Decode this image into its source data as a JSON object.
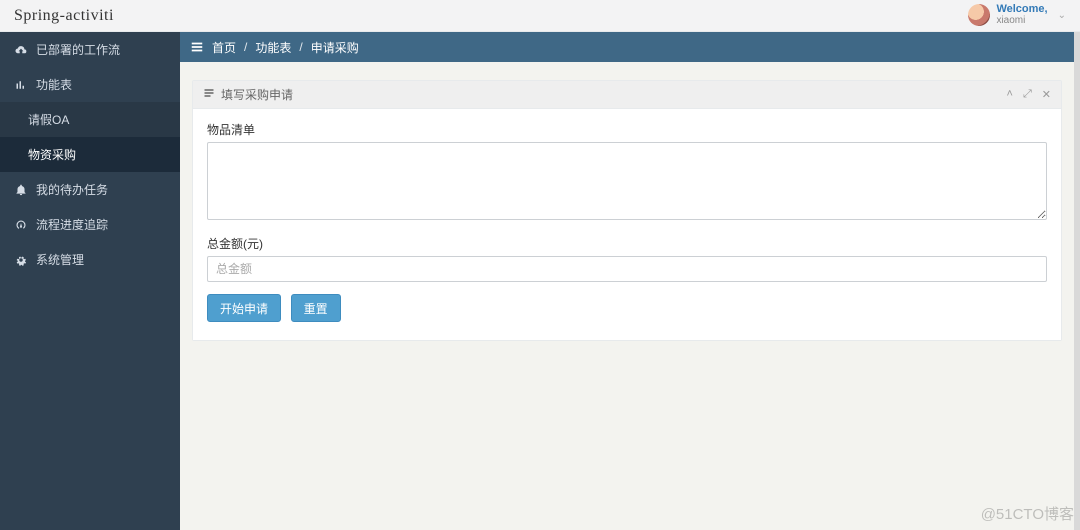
{
  "header": {
    "brand": "Spring-activiti",
    "welcome": "Welcome,",
    "username": "xiaomi"
  },
  "sidebar": {
    "items": [
      {
        "label": "已部署的工作流",
        "icon": "cloud-upload"
      },
      {
        "label": "功能表",
        "icon": "bar-chart",
        "children": [
          {
            "label": "请假OA"
          },
          {
            "label": "物资采购",
            "active": true
          }
        ]
      },
      {
        "label": "我的待办任务",
        "icon": "bell"
      },
      {
        "label": "流程进度追踪",
        "icon": "dashboard"
      },
      {
        "label": "系统管理",
        "icon": "gear"
      }
    ]
  },
  "breadcrumb": {
    "home": "首页",
    "section": "功能表",
    "page": "申请采购"
  },
  "panel": {
    "title": "填写采购申请",
    "fields": {
      "items_label": "物品清单",
      "items_value": "",
      "amount_label": "总金额(元)",
      "amount_placeholder": "总金额",
      "amount_value": ""
    },
    "buttons": {
      "submit": "开始申请",
      "reset": "重置"
    }
  },
  "watermark": "@51CTO博客"
}
